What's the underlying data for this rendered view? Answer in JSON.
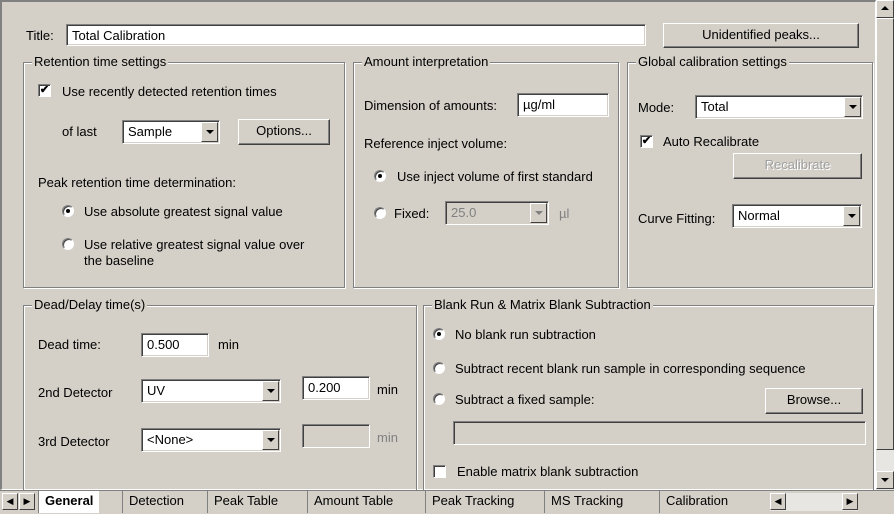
{
  "title_label": "Title:",
  "title_value": "Total Calibration",
  "unidentified_peaks_button": "Unidentified peaks...",
  "retention": {
    "group_title": "Retention time settings",
    "use_recent_label": "Use recently detected retention times",
    "use_recent_checked": true,
    "of_last_label": "of last",
    "of_last_value": "Sample",
    "options_button": "Options...",
    "peak_rt_label": "Peak retention time determination:",
    "opt_absolute": "Use absolute greatest signal value",
    "opt_relative_line1": "Use relative greatest signal value over",
    "opt_relative_line2": "the baseline",
    "selected": "absolute"
  },
  "amount": {
    "group_title": "Amount interpretation",
    "dimension_label": "Dimension of amounts:",
    "dimension_value": "µg/ml",
    "ref_volume_label": "Reference inject volume:",
    "opt_first_standard": "Use inject volume of first standard",
    "opt_fixed": "Fixed:",
    "fixed_value": "25.0",
    "fixed_unit": "µl",
    "selected": "first_standard"
  },
  "global": {
    "group_title": "Global calibration settings",
    "mode_label": "Mode:",
    "mode_value": "Total",
    "auto_recalibrate_label": "Auto Recalibrate",
    "auto_recalibrate_checked": true,
    "recalibrate_button": "Recalibrate",
    "curve_fitting_label": "Curve Fitting:",
    "curve_fitting_value": "Normal"
  },
  "dead_delay": {
    "group_title": "Dead/Delay time(s)",
    "dead_time_label": "Dead time:",
    "dead_time_value": "0.500",
    "dead_time_unit": "min",
    "second_detector_label": "2nd Detector",
    "second_detector_value": "UV",
    "second_detector_time": "0.200",
    "second_detector_unit": "min",
    "third_detector_label": "3rd Detector",
    "third_detector_value": "<None>",
    "third_detector_time": "",
    "third_detector_unit": "min"
  },
  "blank_run": {
    "group_title": "Blank Run & Matrix Blank Subtraction",
    "opt_none": "No blank run subtraction",
    "opt_recent": "Subtract recent blank run sample in corresponding sequence",
    "opt_fixed": "Subtract a fixed sample:",
    "browse_button": "Browse...",
    "fixed_sample_value": "",
    "selected": "none",
    "matrix_label": "Enable matrix blank subtraction",
    "matrix_checked": false
  },
  "tabs": [
    "General",
    "Detection",
    "Peak Table",
    "Amount Table",
    "Peak Tracking",
    "MS Tracking",
    "Calibration"
  ],
  "active_tab": "General",
  "check_mark": "✔",
  "colors": {
    "face": "#d4d0c8",
    "shadow": "#808080",
    "highlight": "#ffffff",
    "disabled_text": "#808080"
  }
}
